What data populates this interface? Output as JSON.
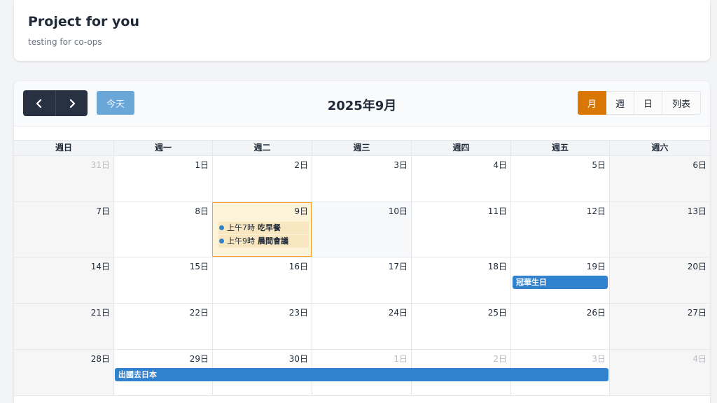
{
  "header": {
    "title": "Project for you",
    "subtitle": "testing for co-ops"
  },
  "toolbar": {
    "prev_icon": "chevron-left-icon",
    "next_icon": "chevron-right-icon",
    "today_label": "今天",
    "month_title": "2025年9月",
    "views": [
      "月",
      "週",
      "日",
      "列表"
    ],
    "active_view": "月"
  },
  "calendar": {
    "weekdays": [
      "週日",
      "週一",
      "週二",
      "週三",
      "週四",
      "週五",
      "週六"
    ],
    "weeks": [
      [
        "31日",
        "1日",
        "2日",
        "3日",
        "4日",
        "5日",
        "6日"
      ],
      [
        "7日",
        "8日",
        "9日",
        "10日",
        "11日",
        "12日",
        "13日"
      ],
      [
        "14日",
        "15日",
        "16日",
        "17日",
        "18日",
        "19日",
        "20日"
      ],
      [
        "21日",
        "22日",
        "23日",
        "24日",
        "25日",
        "26日",
        "27日"
      ],
      [
        "28日",
        "29日",
        "30日",
        "1日",
        "2日",
        "3日",
        "4日"
      ]
    ],
    "today_label": "9日",
    "events": {
      "breakfast": {
        "time": "上午7時",
        "name": "吃早餐"
      },
      "meeting": {
        "time": "上午9時",
        "name": "晨間會議"
      },
      "birthday": {
        "name": "冠華生日"
      },
      "trip": {
        "name": "出國去日本"
      }
    },
    "colors": {
      "accent": "#d97706",
      "event": "#3182ce",
      "nav": "#273142",
      "today_bg": "#fdf3d8"
    }
  }
}
